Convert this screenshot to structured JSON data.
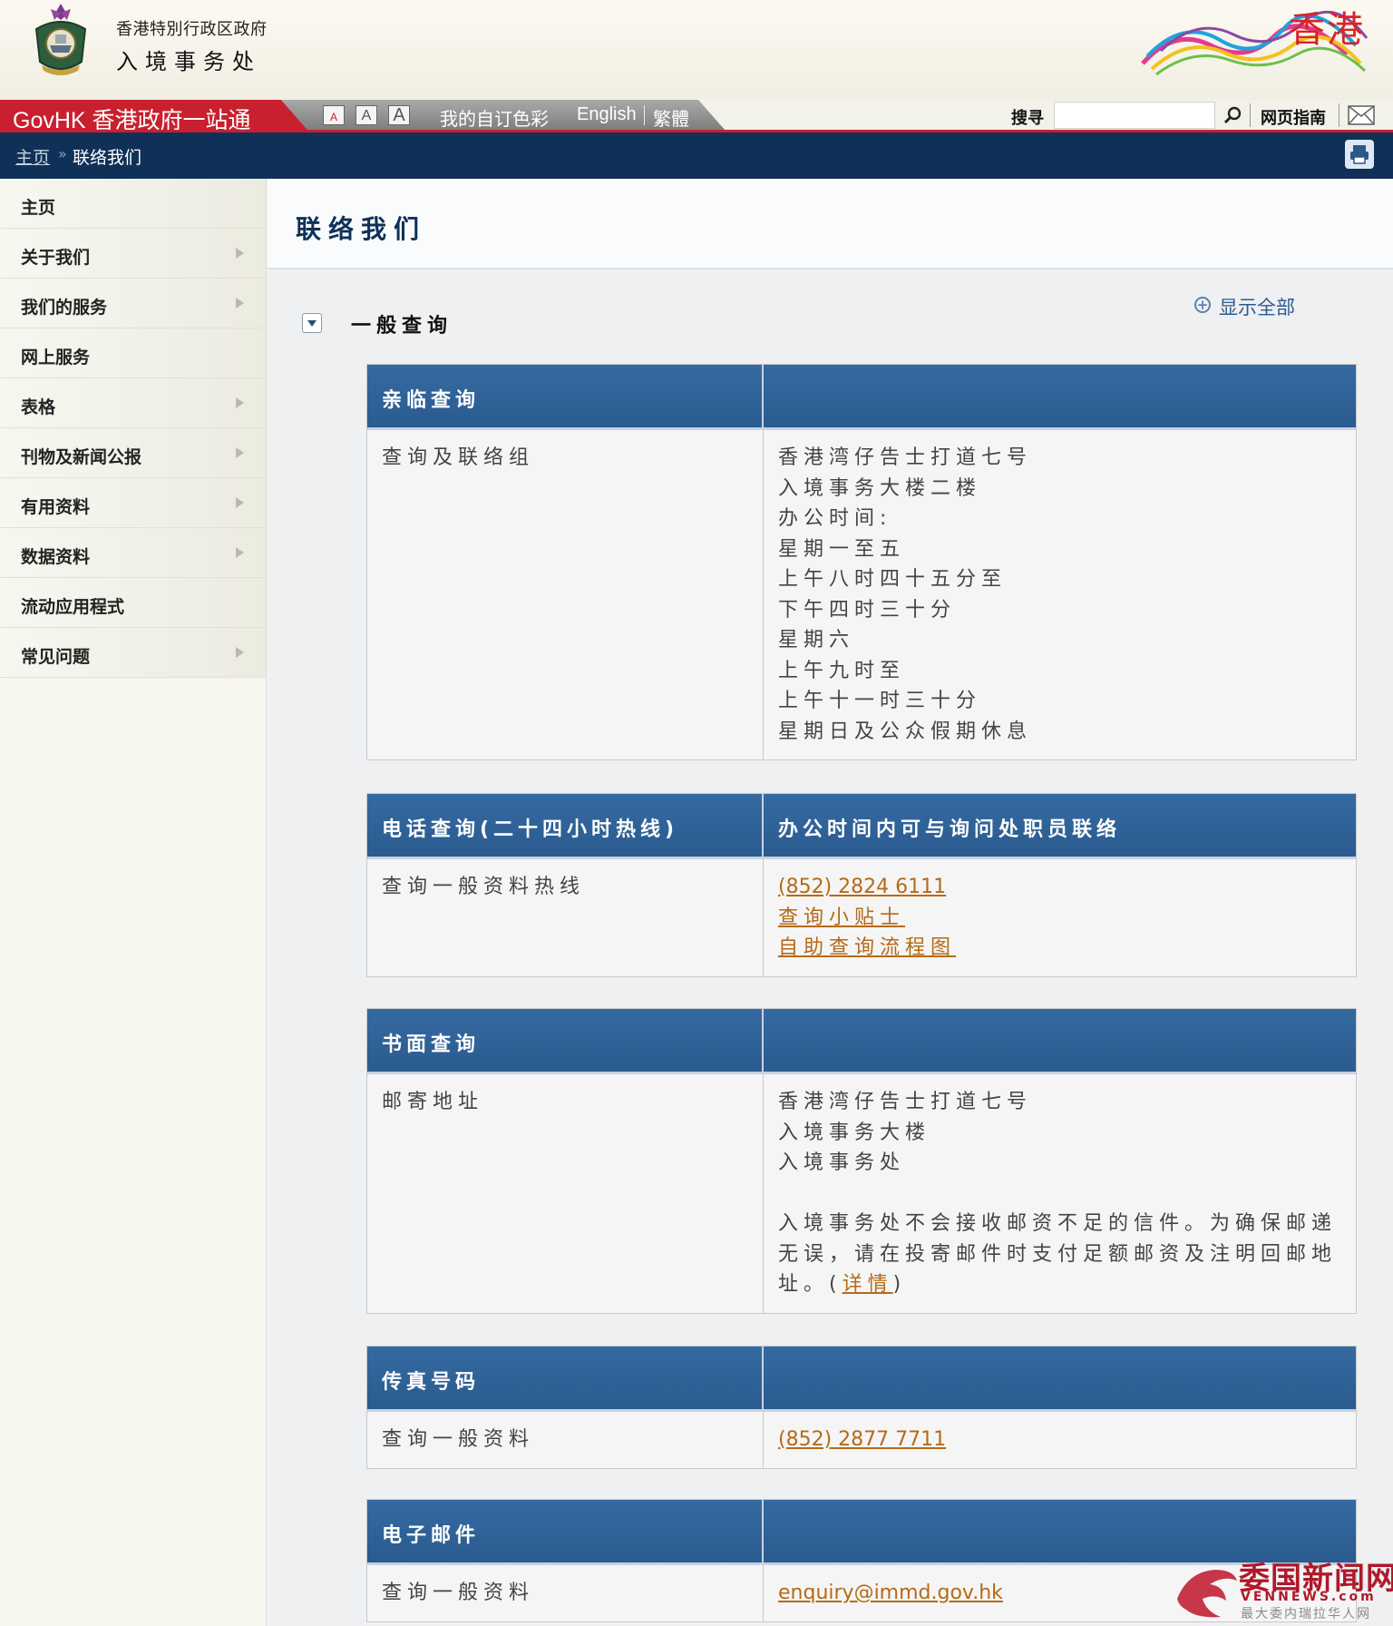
{
  "header": {
    "logo_line1": "香港特別行政区政府",
    "logo_line2": "入境事务处",
    "brand_text": "香港"
  },
  "toolbar": {
    "govhk_label": "GovHK 香港政府一站通",
    "font_small": "A",
    "font_medium": "A",
    "font_large": "A",
    "custom_color": "我的自订色彩",
    "english": "English",
    "traditional": "繁體",
    "search_label": "搜寻",
    "search_value": "",
    "sitemap": "网页指南"
  },
  "breadcrumb": {
    "home": "主页",
    "separator": "»",
    "current": "联络我们"
  },
  "sidebar": {
    "items": [
      {
        "label": "主页",
        "has_arrow": false
      },
      {
        "label": "关于我们",
        "has_arrow": true
      },
      {
        "label": "我们的服务",
        "has_arrow": true
      },
      {
        "label": "网上服务",
        "has_arrow": false
      },
      {
        "label": "表格",
        "has_arrow": true
      },
      {
        "label": "刊物及新闻公报",
        "has_arrow": true
      },
      {
        "label": "有用资料",
        "has_arrow": true
      },
      {
        "label": "数据资料",
        "has_arrow": true
      },
      {
        "label": "流动应用程式",
        "has_arrow": false
      },
      {
        "label": "常见问题",
        "has_arrow": true
      }
    ]
  },
  "main": {
    "page_title": "联络我们",
    "section_title": "一般查询",
    "show_all": "显示全部",
    "tables": [
      {
        "h1": "亲临查询",
        "h2": "",
        "label": "查询及联络组",
        "lines": [
          "香港湾仔告士打道七号",
          "入境事务大楼二楼",
          "办公时间:",
          "星期一至五",
          "上午八时四十五分至",
          "下午四时三十分",
          "星期六",
          "上午九时至",
          "上午十一时三十分",
          "星期日及公众假期休息"
        ]
      },
      {
        "h1": "电话查询(二十四小时热线)",
        "h2": "办公时间内可与询问处职员联络",
        "label": "查询一般资料热线",
        "link1": "(852) 2824 6111",
        "link2": "查询小贴士",
        "link3": "自助查询流程图"
      },
      {
        "h1": "书面查询",
        "h2": "",
        "label": "邮寄地址",
        "lines": [
          "香港湾仔告士打道七号",
          "入境事务大楼",
          "入境事务处"
        ],
        "note": "入境事务处不会接收邮资不足的信件。为确保邮递无误，请在投寄邮件时支付足额邮资及注明回邮地址。(",
        "note_link": "详情",
        "note_end": ")"
      },
      {
        "h1": "传真号码",
        "h2": "",
        "label": "查询一般资料",
        "link1": "(852) 2877 7711"
      },
      {
        "h1": "电子邮件",
        "h2": "",
        "label": "查询一般资料",
        "link1": "enquiry@immd.gov.hk"
      }
    ]
  },
  "watermark": {
    "title": "委国新闻网",
    "url": "VENNEWS.com",
    "sub": "最大委内瑞拉华人网"
  },
  "colors": {
    "govhk_red": "#c8202f",
    "nav_navy": "#0f3158",
    "table_header_blue": "#2f62978",
    "link_orange": "#b56a17"
  }
}
